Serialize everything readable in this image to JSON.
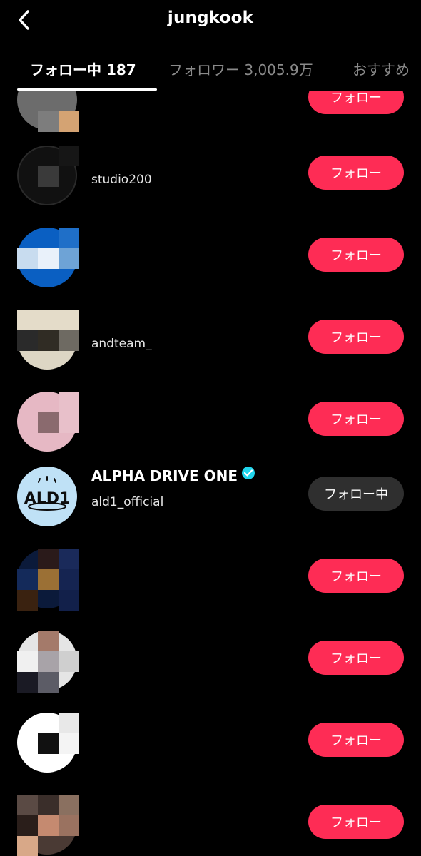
{
  "header": {
    "title": "jungkook",
    "back_icon": "chevron-left-icon"
  },
  "tabs": [
    {
      "label": "フォロー中 187",
      "active": true
    },
    {
      "label": "フォロワー 3,005.9万",
      "active": false
    },
    {
      "label": "おすすめ",
      "active": false
    }
  ],
  "buttons": {
    "follow": "フォロー",
    "following": "フォロー中"
  },
  "colors": {
    "follow_button": "#fe2c55",
    "following_button": "#2f2f2f",
    "verified_badge": "#20d5ec",
    "background": "#000000"
  },
  "rows": [
    {
      "name": "",
      "handle": "",
      "button": "フォロー"
    },
    {
      "name": "",
      "handle": "studio200",
      "button": "フォロー"
    },
    {
      "name": "",
      "handle": "",
      "button": "フォロー"
    },
    {
      "name": "",
      "handle": "andteam_",
      "button": "フォロー"
    },
    {
      "name": "",
      "handle": "",
      "button": "フォロー"
    },
    {
      "name": "ALPHA DRIVE ONE",
      "handle": "ald1_official",
      "verified": true,
      "button": "フォロー中",
      "avatar_text": "ALD1"
    },
    {
      "name": "",
      "handle": "",
      "button": "フォロー"
    },
    {
      "name": "",
      "handle": "",
      "button": "フォロー"
    },
    {
      "name": "",
      "handle": "",
      "button": "フォロー"
    },
    {
      "name": "",
      "handle": "",
      "button": "フォロー"
    }
  ]
}
